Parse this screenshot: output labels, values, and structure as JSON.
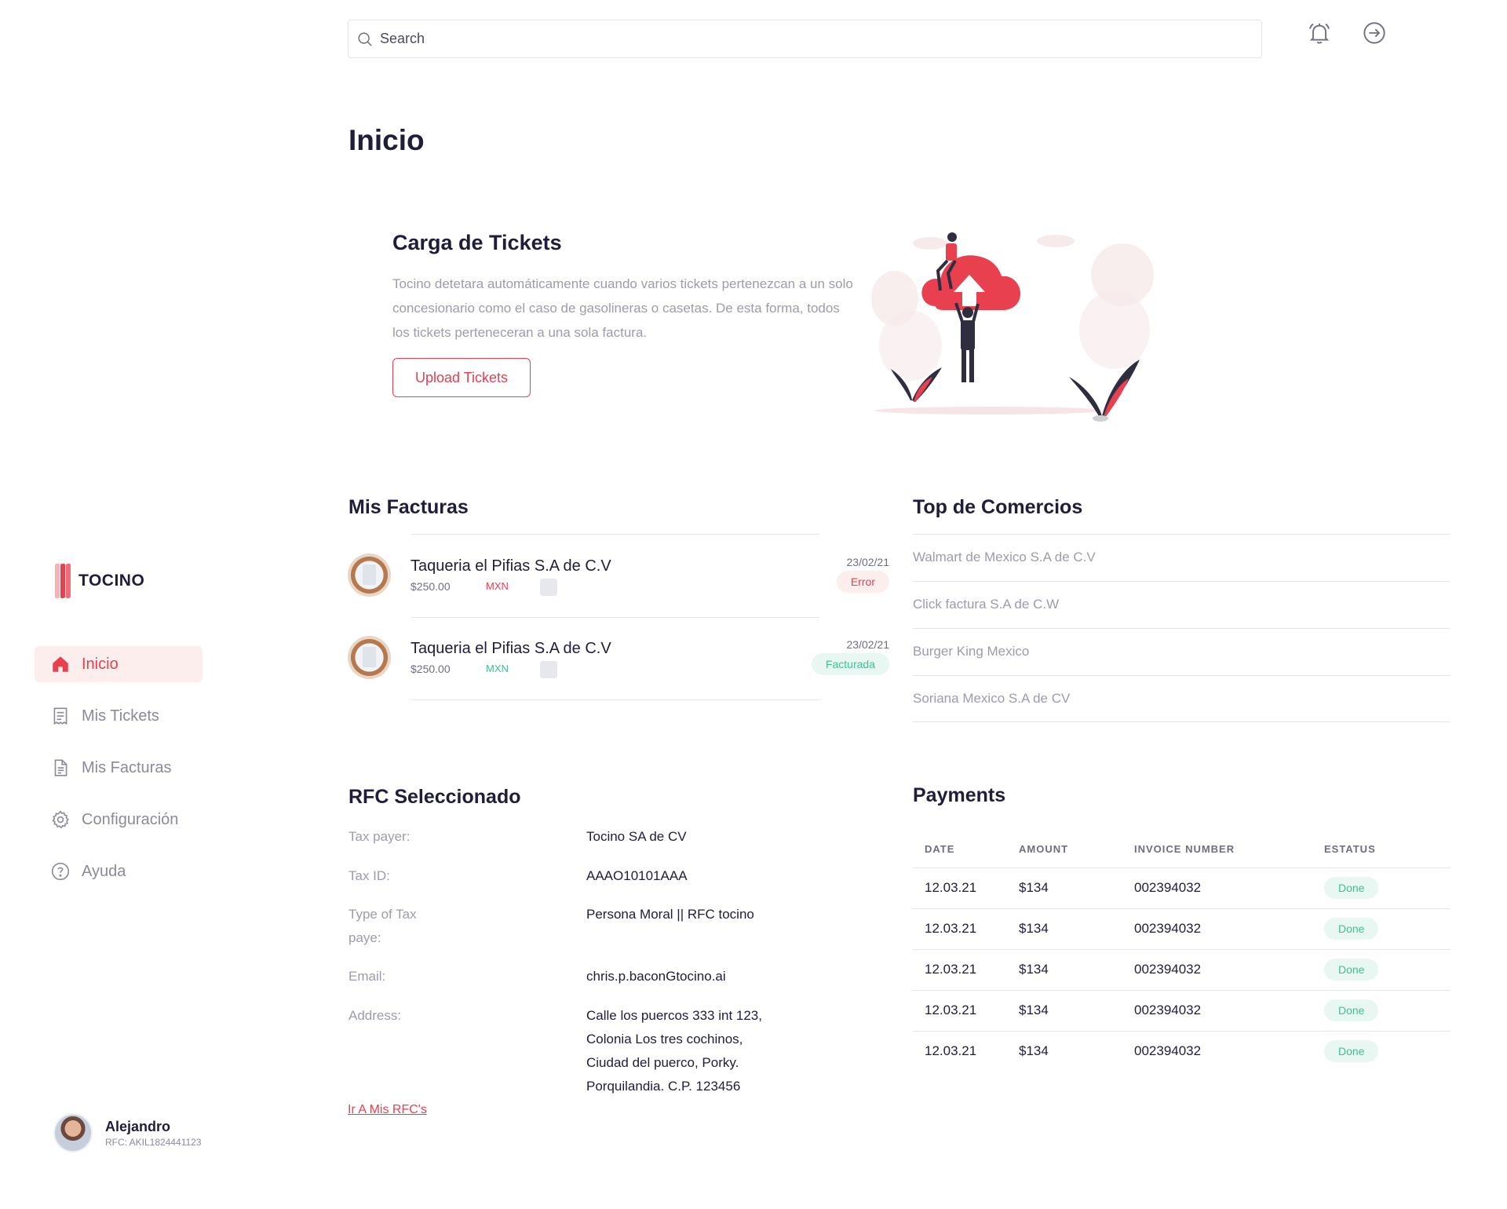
{
  "brand": {
    "name": "TOCINO",
    "accent": "#e8404f",
    "success": "#3fbf96"
  },
  "search": {
    "placeholder": "Search"
  },
  "header_icons": [
    "bell-icon",
    "logout-icon"
  ],
  "sidebar": {
    "items": [
      {
        "label": "Inicio",
        "icon": "home-icon",
        "active": true
      },
      {
        "label": "Mis Tickets",
        "icon": "receipt-icon",
        "active": false
      },
      {
        "label": "Mis Facturas",
        "icon": "document-icon",
        "active": false
      },
      {
        "label": "Configuración",
        "icon": "gear-icon",
        "active": false
      },
      {
        "label": "Ayuda",
        "icon": "help-icon",
        "active": false
      }
    ]
  },
  "user": {
    "name": "Alejandro",
    "rfc": "RFC: AKIL1824441123"
  },
  "page": {
    "title": "Inicio"
  },
  "promo": {
    "title": "Carga de Tickets",
    "text": "Tocino detetara automáticamente cuando varios tickets pertenezcan a un solo concesionario como el caso de gasolineras o casetas. De esta forma, todos los tickets perteneceran a una sola factura.",
    "button": "Upload Tickets"
  },
  "facturas": {
    "title": "Mis Facturas",
    "items": [
      {
        "name": "Taqueria el Pifias S.A de C.V",
        "amount": "$250.00",
        "currency": "MXN",
        "date": "23/02/21",
        "status": "Error",
        "status_type": "error"
      },
      {
        "name": "Taqueria el Pifias S.A de C.V",
        "amount": "$250.00",
        "currency": "MXN",
        "date": "23/02/21",
        "status": "Facturada",
        "status_type": "ok"
      }
    ]
  },
  "comercios": {
    "title": "Top de Comercios",
    "items": [
      "Walmart de Mexico S.A de C.V",
      "Click factura S.A de C.W",
      "Burger King Mexico",
      "Soriana Mexico S.A de CV"
    ]
  },
  "rfc": {
    "title": "RFC Seleccionado",
    "rows": [
      {
        "label": "Tax payer:",
        "value": "Tocino SA de CV"
      },
      {
        "label": "Tax ID:",
        "value": "AAAO10101AAA"
      },
      {
        "label": "Type of Tax paye:",
        "value": "Persona Moral || RFC tocino"
      },
      {
        "label": "Email:",
        "value": "chris.p.baconGtocino.ai"
      },
      {
        "label": "Address:",
        "value": "Calle los puercos 333 int 123, Colonia Los tres cochinos, Ciudad del puerco, Porky. Porquilandia. C.P. 123456"
      }
    ],
    "link": "Ir A Mis RFC's"
  },
  "payments": {
    "title": "Payments",
    "columns": [
      "DATE",
      "AMOUNT",
      "INVOICE NUMBER",
      "ESTATUS"
    ],
    "rows": [
      {
        "date": "12.03.21",
        "amount": "$134",
        "invoice": "002394032",
        "status": "Done"
      },
      {
        "date": "12.03.21",
        "amount": "$134",
        "invoice": "002394032",
        "status": "Done"
      },
      {
        "date": "12.03.21",
        "amount": "$134",
        "invoice": "002394032",
        "status": "Done"
      },
      {
        "date": "12.03.21",
        "amount": "$134",
        "invoice": "002394032",
        "status": "Done"
      },
      {
        "date": "12.03.21",
        "amount": "$134",
        "invoice": "002394032",
        "status": "Done"
      }
    ]
  }
}
